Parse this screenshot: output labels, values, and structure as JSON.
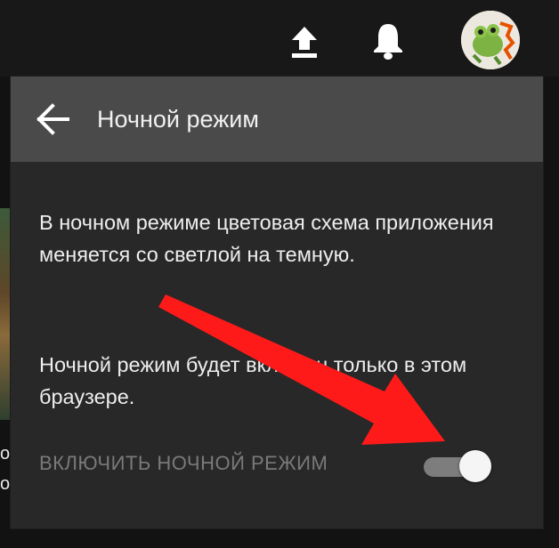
{
  "topbar": {
    "upload_icon": "upload-icon",
    "bell_icon": "bell-icon",
    "avatar": "avatar"
  },
  "side": {
    "text_top": "о",
    "text_bottom": "о"
  },
  "panel": {
    "title": "Ночной режим",
    "back_icon": "arrow-left-icon",
    "description_1": "В ночном режиме цветовая схема приложения меняется со светлой на темную.",
    "description_2": "Ночной режим будет включен только в этом браузере.",
    "toggle_label": "ВКЛЮЧИТЬ НОЧНОЙ РЕЖИМ",
    "toggle_state": "on"
  },
  "colors": {
    "page_bg": "#121212",
    "topbar_bg": "#181818",
    "panel_bg": "#282828",
    "header_bg": "#4a4a4a",
    "annotation_arrow": "#ff1a1a"
  }
}
